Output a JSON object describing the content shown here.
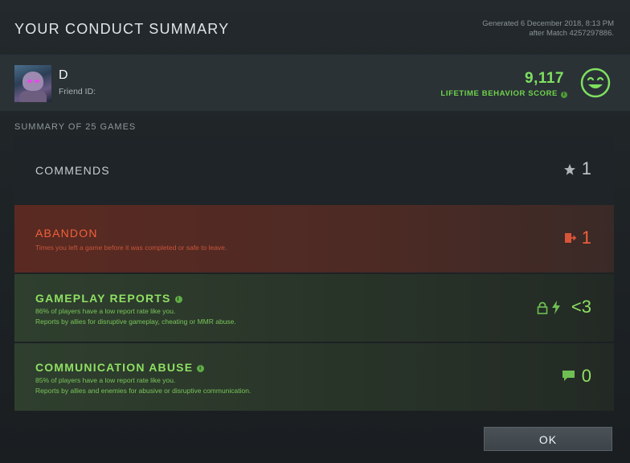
{
  "header": {
    "title": "YOUR CONDUCT SUMMARY",
    "generated_line1": "Generated 6 December 2018, 8:13 PM",
    "generated_line2": "after Match 4257297886."
  },
  "player": {
    "name": "D",
    "friend_id_label": "Friend ID:",
    "score": "9,117",
    "score_label": "LIFETIME BEHAVIOR SCORE"
  },
  "summary_label": "SUMMARY OF 25 GAMES",
  "cards": {
    "commends": {
      "name": "COMMENDS",
      "value": "1",
      "icon": "star-icon"
    },
    "abandon": {
      "name": "ABANDON",
      "desc": "Times you left a game before it was completed or safe to leave.",
      "value": "1",
      "icon": "exit-door-icon"
    },
    "gameplay": {
      "name": "GAMEPLAY REPORTS",
      "desc1": "86% of players have a low report rate like you.",
      "desc2": "Reports by allies for disruptive gameplay, cheating or MMR abuse.",
      "value": "<3",
      "icons": [
        "lock-icon",
        "lightning-icon"
      ]
    },
    "communication": {
      "name": "COMMUNICATION ABUSE",
      "desc1": "85% of players have a low report rate like you.",
      "desc2": "Reports by allies and enemies for abusive or disruptive communication.",
      "value": "0",
      "icon": "chat-bubble-icon"
    }
  },
  "ok_label": "OK",
  "colors": {
    "good": "#8fe063",
    "bad": "#f3603a"
  }
}
